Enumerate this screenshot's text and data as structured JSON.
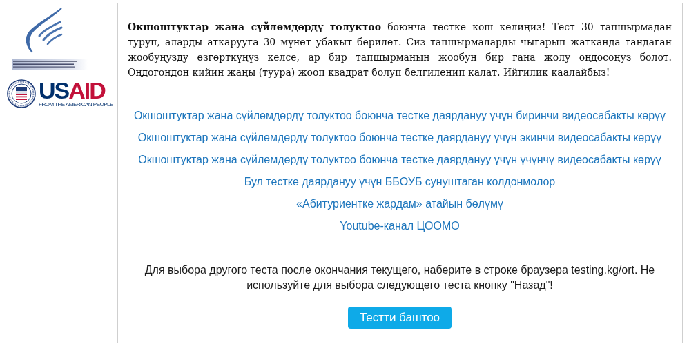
{
  "usaid_logo": {
    "wordmark": "US**AID**",
    "tagline": "FROM THE AMERICAN PEOPLE"
  },
  "intro": "**Окшоштуктар жана сүйлөмдөрдү толуктоо** боюнча тестке кош келиңиз! Тест 30 тапшырмадан туруп, аларды аткарууга 30 мүнөт убакыт берилет. Сиз тапшырмаларды чыгарып жатканда тандаган жообуңузду өзгөрткүңүз келсе, ар бир тапшырманын жообун бир гана жолу оңдосоңуз болот. Оңдогондон кийин жаңы (туура) жооп квадрат болуп белгиленип калат. Ийгилик каалайбыз!",
  "links": [
    "Окшоштуктар жана сүйлөмдөрдү толуктоо боюнча тестке даярдануу үчүн биринчи видеосабакты көрүү",
    "Окшоштуктар жана сүйлөмдөрдү толуктоо боюнча тестке даярдануу үчүн экинчи видеосабакты көрүү",
    "Окшоштуктар жана сүйлөмдөрдү толуктоо боюнча тестке даярдануу үчүн үчүнчү видеосабакты көрүү",
    "Бул тестке даярдануу үчүн ББОУБ сунуштаган колдонмолор",
    "«Абитуриентке жардам» атайын бөлүмү",
    "Youtube-канал ЦООМО"
  ],
  "notice": "Для выбора другого теста после окончания текущего, наберите в строке браузера testing.kg/ort. Не используйте для выбора следующего теста кнопку \"Назад\"!",
  "start_button": "Тестти баштоо"
}
